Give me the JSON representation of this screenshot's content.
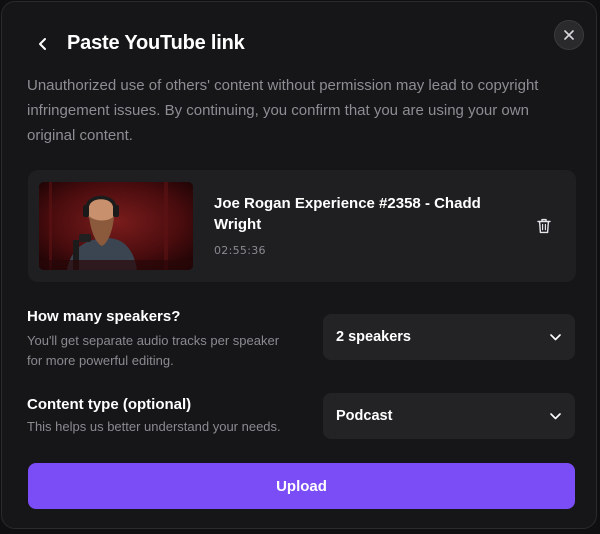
{
  "header": {
    "title": "Paste YouTube link"
  },
  "warning_text": "Unauthorized use of others' content without permission may lead to copyright infringement issues. By continuing, you confirm that you are using your own original content.",
  "video": {
    "title": "Joe Rogan Experience #2358 - Chadd Wright",
    "duration": "02:55:36"
  },
  "speakers": {
    "label": "How many speakers?",
    "help": "You'll get separate audio tracks per speaker for more powerful editing.",
    "selected": "2 speakers"
  },
  "content_type": {
    "label": "Content type (optional)",
    "help": "This helps us better understand your needs.",
    "selected": "Podcast"
  },
  "upload_label": "Upload",
  "icons": [
    "back-icon",
    "close-icon",
    "trash-icon",
    "chevron-down-icon"
  ],
  "colors": {
    "modal_bg": "#161618",
    "card_bg": "#1f1f22",
    "accent": "#7a4df6",
    "muted_text": "#8d8d93"
  }
}
